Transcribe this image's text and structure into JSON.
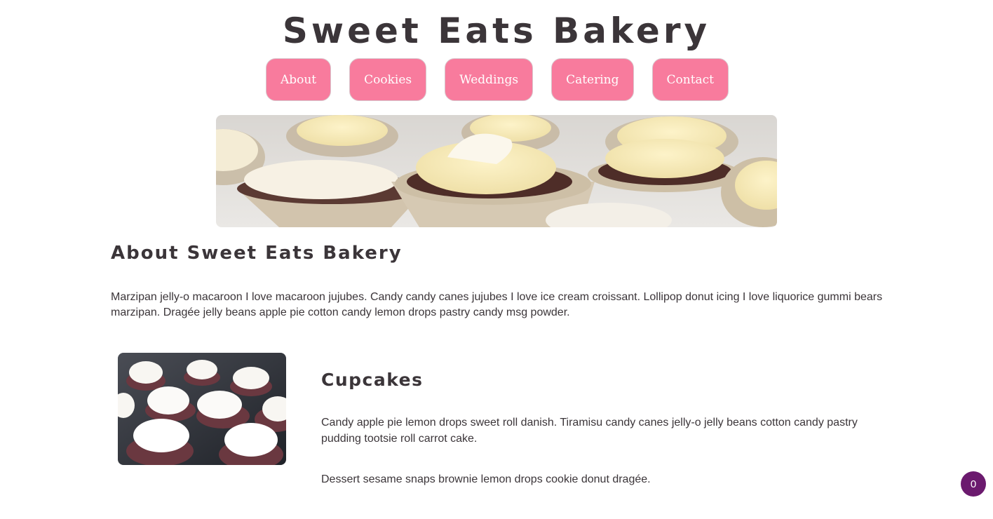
{
  "header": {
    "title": "Sweet Eats Bakery"
  },
  "nav": {
    "items": [
      {
        "label": "About"
      },
      {
        "label": "Cookies"
      },
      {
        "label": "Weddings"
      },
      {
        "label": "Catering"
      },
      {
        "label": "Contact"
      }
    ]
  },
  "about": {
    "heading": "About Sweet Eats Bakery",
    "text": "Marzipan jelly-o macaroon I love macaroon jujubes. Candy candy canes jujubes I love ice cream croissant. Lollipop donut icing I love liquorice gummi bears marzipan. Dragée jelly beans apple pie cotton candy lemon drops pastry candy msg powder."
  },
  "cupcakes": {
    "heading": "Cupcakes",
    "text1": "Candy apple pie lemon drops sweet roll danish. Tiramisu candy canes jelly-o jelly beans cotton candy pastry pudding tootsie roll carrot cake.",
    "text2": "Dessert sesame snaps brownie lemon drops cookie donut dragée."
  },
  "cart": {
    "count": "0"
  },
  "colors": {
    "nav_button": "#f87b9d",
    "text": "#3b3539",
    "cart_badge": "#6b1a6e"
  }
}
